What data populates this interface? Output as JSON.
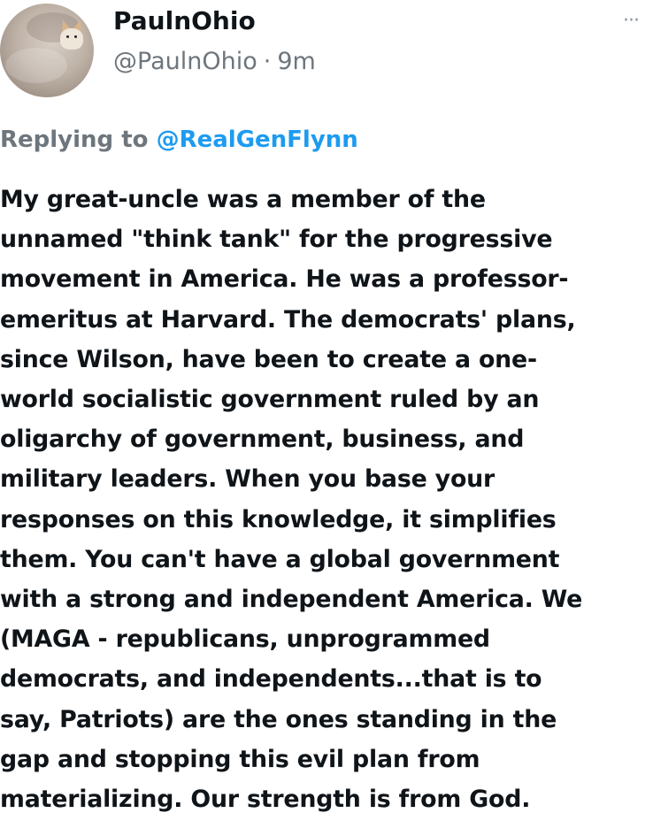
{
  "author": {
    "display_name": "PaulnOhio",
    "handle": "@PaulnOhio",
    "separator": "·",
    "time": "9m",
    "avatar_icon": "avatar-dog-on-beanbag"
  },
  "more_button_label": "···",
  "reply": {
    "prefix": "Replying to",
    "mention": "@RealGenFlynn"
  },
  "tweet": {
    "lines": [
      "My great-uncle was a member of the",
      "unnamed \"think tank\" for the progressive",
      "movement in America. He was a professor-",
      "emeritus at Harvard. The democrats' plans,",
      "since Wilson, have been to create a one-",
      "world socialistic government ruled by an",
      "oligarchy of government, business, and",
      "military leaders. When you base your",
      "responses on this knowledge, it simplifies",
      "them. You can't have a global government",
      "with a strong and independent America. We",
      "(MAGA - republicans, unprogrammed",
      "democrats, and independents...that is to",
      "say, Patriots) are the ones standing in the",
      "gap and stopping this evil plan from",
      "materializing. Our strength is from God."
    ]
  },
  "colors": {
    "text": "#0f1419",
    "secondary": "#6e767d",
    "link": "#1d9bf0"
  }
}
